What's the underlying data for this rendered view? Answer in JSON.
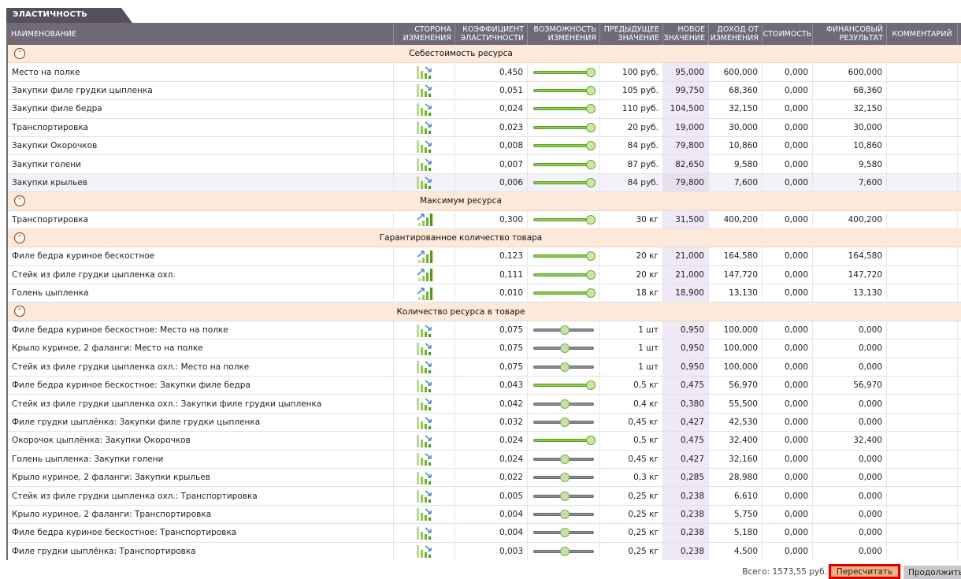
{
  "tab": {
    "label": "ЭЛАСТИЧНОСТЬ"
  },
  "columns": {
    "name": "НАИМЕНОВАНИЕ",
    "side": [
      "СТОРОНА",
      "ИЗМЕНЕНИЯ"
    ],
    "coef": [
      "КОЭФФИЦИЕНТ",
      "ЭЛАСТИЧНОСТИ"
    ],
    "poss": [
      "ВОЗМОЖНОСТЬ",
      "ИЗМЕНЕНИЯ"
    ],
    "prev": [
      "ПРЕДЫДУЩЕЕ",
      "ЗНАЧЕНИЕ"
    ],
    "new": [
      "НОВОЕ",
      "ЗНАЧЕНИЕ"
    ],
    "inc": [
      "ДОХОД ОТ",
      "ИЗМЕНЕНИЯ"
    ],
    "cost": "СТОИМОСТЬ",
    "fin": [
      "ФИНАНСОВЫЙ",
      "РЕЗУЛЬТАТ"
    ],
    "com": "КОММЕНТАРИЙ"
  },
  "icons": {
    "toggle": "collapse-up-icon",
    "down": "chart-down-icon",
    "up": "chart-up-icon"
  },
  "groups": [
    {
      "title": "Себестоимость ресурса",
      "rows": [
        {
          "name": "Место на полке",
          "dir": "down",
          "coef": "0,450",
          "on": true,
          "prev": "100 руб.",
          "new": "95,000",
          "inc": "600,000",
          "cost": "0,000",
          "fin": "600,000"
        },
        {
          "name": "Закупки филе грудки цыпленка",
          "dir": "down",
          "coef": "0,051",
          "on": true,
          "prev": "105 руб.",
          "new": "99,750",
          "inc": "68,360",
          "cost": "0,000",
          "fin": "68,360"
        },
        {
          "name": "Закупки филе бедра",
          "dir": "down",
          "coef": "0,024",
          "on": true,
          "prev": "110 руб.",
          "new": "104,500",
          "inc": "32,150",
          "cost": "0,000",
          "fin": "32,150"
        },
        {
          "name": "Транспортировка",
          "dir": "down",
          "coef": "0,023",
          "on": true,
          "prev": "20 руб.",
          "new": "19,000",
          "inc": "30,000",
          "cost": "0,000",
          "fin": "30,000"
        },
        {
          "name": "Закупки Окорочков",
          "dir": "down",
          "coef": "0,008",
          "on": true,
          "prev": "84 руб.",
          "new": "79,800",
          "inc": "10,860",
          "cost": "0,000",
          "fin": "10,860"
        },
        {
          "name": "Закупки голени",
          "dir": "down",
          "coef": "0,007",
          "on": true,
          "prev": "87 руб.",
          "new": "82,650",
          "inc": "9,580",
          "cost": "0,000",
          "fin": "9,580"
        },
        {
          "name": "Закупки крыльев",
          "dir": "down",
          "coef": "0,006",
          "on": true,
          "prev": "84 руб.",
          "new": "79,800",
          "inc": "7,600",
          "cost": "0,000",
          "fin": "7,600",
          "alt": true
        }
      ]
    },
    {
      "title": "Максимум ресурса",
      "rows": [
        {
          "name": "Транспортировка",
          "dir": "up",
          "coef": "0,300",
          "on": true,
          "prev": "30 кг",
          "new": "31,500",
          "inc": "400,200",
          "cost": "0,000",
          "fin": "400,200"
        }
      ]
    },
    {
      "title": "Гарантированное количество товара",
      "rows": [
        {
          "name": "Филе бедра куриное бескостное",
          "dir": "up",
          "coef": "0,123",
          "on": true,
          "prev": "20 кг",
          "new": "21,000",
          "inc": "164,580",
          "cost": "0,000",
          "fin": "164,580"
        },
        {
          "name": "Стейк из филе грудки цыпленка охл.",
          "dir": "up",
          "coef": "0,111",
          "on": true,
          "prev": "20 кг",
          "new": "21,000",
          "inc": "147,720",
          "cost": "0,000",
          "fin": "147,720"
        },
        {
          "name": "Голень цыпленка",
          "dir": "up",
          "coef": "0,010",
          "on": true,
          "prev": "18 кг",
          "new": "18,900",
          "inc": "13,130",
          "cost": "0,000",
          "fin": "13,130"
        }
      ]
    },
    {
      "title": "Количество ресурса в товаре",
      "rows": [
        {
          "name": "Филе бедра куриное бескостное: Место на полке",
          "dir": "down",
          "coef": "0,075",
          "on": false,
          "prev": "1 шт",
          "new": "0,950",
          "inc": "100,000",
          "cost": "0,000",
          "fin": "0,000"
        },
        {
          "name": "Крыло куриное, 2 фаланги: Место на полке",
          "dir": "down",
          "coef": "0,075",
          "on": false,
          "prev": "1 шт",
          "new": "0,950",
          "inc": "100,000",
          "cost": "0,000",
          "fin": "0,000"
        },
        {
          "name": "Стейк из филе грудки цыпленка охл.: Место на полке",
          "dir": "down",
          "coef": "0,075",
          "on": false,
          "prev": "1 шт",
          "new": "0,950",
          "inc": "100,000",
          "cost": "0,000",
          "fin": "0,000"
        },
        {
          "name": "Филе бедра куриное бескостное: Закупки филе бедра",
          "dir": "down",
          "coef": "0,043",
          "on": true,
          "prev": "0,5 кг",
          "new": "0,475",
          "inc": "56,970",
          "cost": "0,000",
          "fin": "56,970"
        },
        {
          "name": "Стейк из филе грудки цыпленка охл.: Закупки филе грудки цыпленка",
          "dir": "down",
          "coef": "0,042",
          "on": false,
          "prev": "0,4 кг",
          "new": "0,380",
          "inc": "55,500",
          "cost": "0,000",
          "fin": "0,000"
        },
        {
          "name": "Филе грудки цыплёнка: Закупки филе грудки цыпленка",
          "dir": "down",
          "coef": "0,032",
          "on": false,
          "prev": "0,45 кг",
          "new": "0,427",
          "inc": "42,530",
          "cost": "0,000",
          "fin": "0,000"
        },
        {
          "name": "Окорочок цыплёнка: Закупки Окорочков",
          "dir": "down",
          "coef": "0,024",
          "on": true,
          "prev": "0,5 кг",
          "new": "0,475",
          "inc": "32,400",
          "cost": "0,000",
          "fin": "32,400"
        },
        {
          "name": "Голень цыпленка: Закупки голени",
          "dir": "down",
          "coef": "0,024",
          "on": false,
          "prev": "0,45 кг",
          "new": "0,427",
          "inc": "32,160",
          "cost": "0,000",
          "fin": "0,000"
        },
        {
          "name": "Крыло куриное, 2 фаланги: Закупки крыльев",
          "dir": "down",
          "coef": "0,022",
          "on": false,
          "prev": "0,3 кг",
          "new": "0,285",
          "inc": "28,980",
          "cost": "0,000",
          "fin": "0,000"
        },
        {
          "name": "Стейк из филе грудки цыпленка охл.: Транспортировка",
          "dir": "down",
          "coef": "0,005",
          "on": false,
          "prev": "0,25 кг",
          "new": "0,238",
          "inc": "6,610",
          "cost": "0,000",
          "fin": "0,000"
        },
        {
          "name": "Крыло куриное, 2 фаланги: Транспортировка",
          "dir": "down",
          "coef": "0,004",
          "on": false,
          "prev": "0,25 кг",
          "new": "0,238",
          "inc": "5,750",
          "cost": "0,000",
          "fin": "0,000"
        },
        {
          "name": "Филе бедра куриное бескостное: Транспортировка",
          "dir": "down",
          "coef": "0,004",
          "on": false,
          "prev": "0,25 кг",
          "new": "0,238",
          "inc": "5,180",
          "cost": "0,000",
          "fin": "0,000"
        },
        {
          "name": "Филе грудки цыплёнка: Транспортировка",
          "dir": "down",
          "coef": "0,003",
          "on": false,
          "prev": "0,25 кг",
          "new": "0,238",
          "inc": "4,500",
          "cost": "0,000",
          "fin": "0,000"
        }
      ]
    }
  ],
  "footer": {
    "total": "Всего: 1573,55 руб.",
    "recalc": "Пересчитать",
    "continue": "Продолжить"
  }
}
